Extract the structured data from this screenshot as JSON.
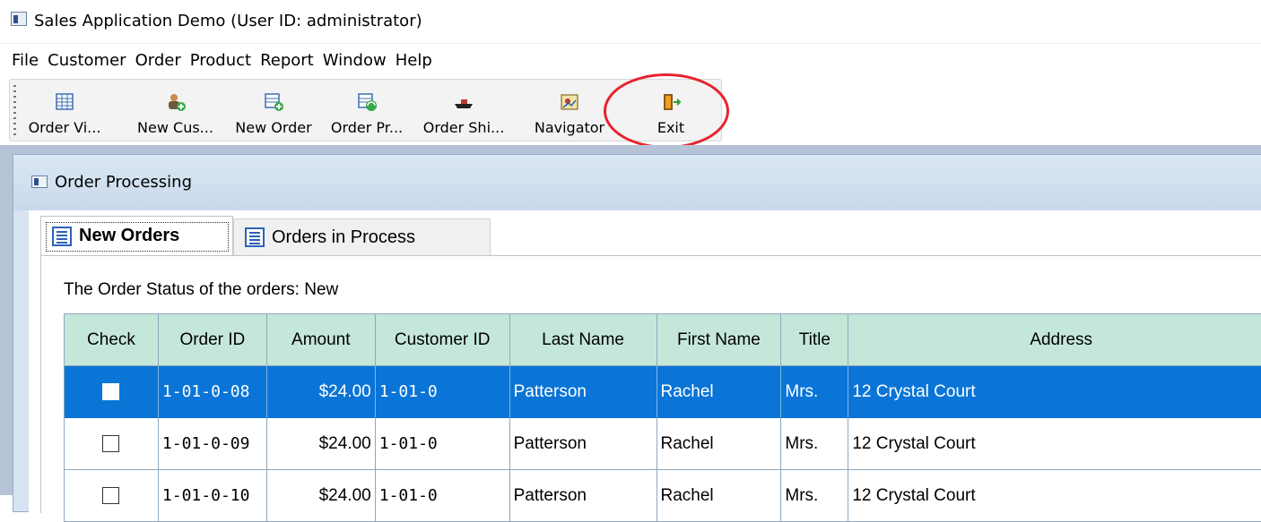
{
  "app": {
    "title": "Sales Application Demo (User ID: administrator)"
  },
  "menu": [
    "File",
    "Customer",
    "Order",
    "Product",
    "Report",
    "Window",
    "Help"
  ],
  "toolbar": {
    "buttons": [
      {
        "label": "Order Vi...",
        "icon": "order-view-icon"
      },
      {
        "label": "New Cus...",
        "icon": "new-customer-icon"
      },
      {
        "label": "New Order",
        "icon": "new-order-icon"
      },
      {
        "label": "Order Pr...",
        "icon": "order-processing-icon"
      },
      {
        "label": "Order Shi...",
        "icon": "order-shipping-icon"
      },
      {
        "label": "Navigator",
        "icon": "navigator-icon"
      },
      {
        "label": "Exit",
        "icon": "exit-door-icon"
      }
    ],
    "highlight_color": "#e8232e"
  },
  "child_window": {
    "title": "Order Processing"
  },
  "tabs": [
    {
      "label": "New Orders",
      "active": true
    },
    {
      "label": "Orders in Process",
      "active": false
    }
  ],
  "status_text": "The Order Status of the orders: New",
  "grid": {
    "columns": [
      "Check",
      "Order ID",
      "Amount",
      "Customer ID",
      "Last Name",
      "First Name",
      "Title",
      "Address"
    ],
    "rows": [
      {
        "selected": true,
        "order_id": "1-01-0-08",
        "amount": "$24.00",
        "customer_id": "1-01-0",
        "last_name": "Patterson",
        "first_name": "Rachel",
        "title": "Mrs.",
        "address": "12 Crystal Court"
      },
      {
        "selected": false,
        "order_id": "1-01-0-09",
        "amount": "$24.00",
        "customer_id": "1-01-0",
        "last_name": "Patterson",
        "first_name": "Rachel",
        "title": "Mrs.",
        "address": "12 Crystal Court"
      },
      {
        "selected": false,
        "order_id": "1-01-0-10",
        "amount": "$24.00",
        "customer_id": "1-01-0",
        "last_name": "Patterson",
        "first_name": "Rachel",
        "title": "Mrs.",
        "address": "12 Crystal Court"
      }
    ]
  },
  "colors": {
    "selection": "#0a75d6",
    "header_bg": "#c5e7d9",
    "mdi_bg": "#b6c3d6"
  }
}
